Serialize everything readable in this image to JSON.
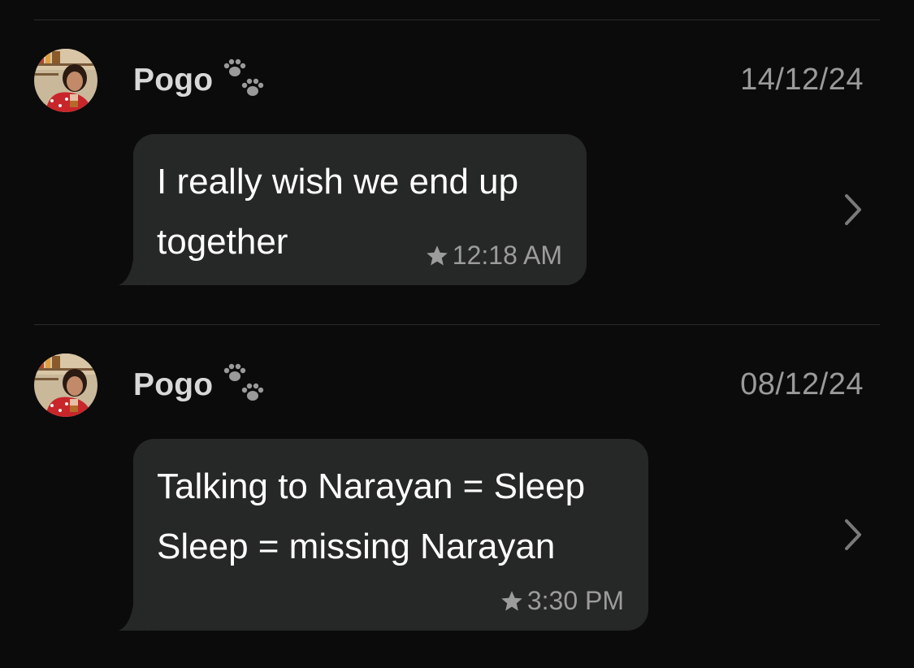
{
  "messages": [
    {
      "sender": "Pogo",
      "sender_badge_icon": "paw-prints-icon",
      "date": "14/12/24",
      "text": "I really wish we end up\ntogether",
      "starred": true,
      "time": "12:18 AM"
    },
    {
      "sender": "Pogo",
      "sender_badge_icon": "paw-prints-icon",
      "date": "08/12/24",
      "text": "Talking to Narayan = Sleep\nSleep = missing Narayan",
      "starred": true,
      "time": "3:30 PM"
    }
  ],
  "colors": {
    "background": "#0b0b0b",
    "bubble": "#262727",
    "secondary_text": "#9a9a9a",
    "divider": "#2a2a2a"
  }
}
